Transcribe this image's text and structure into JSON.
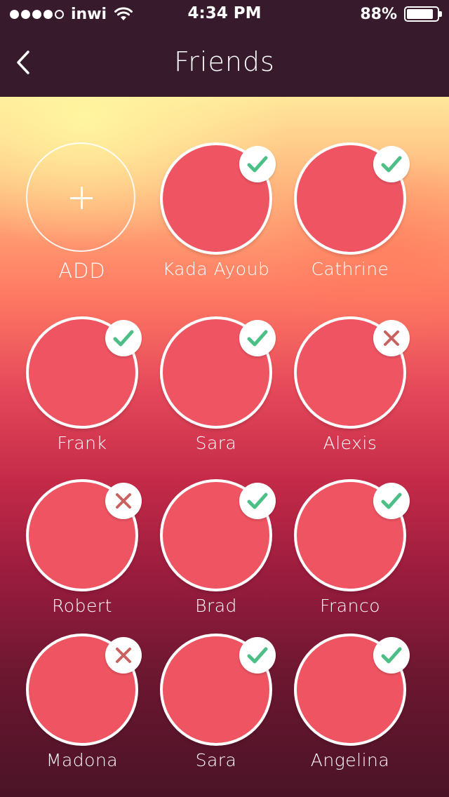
{
  "status_bar": {
    "carrier": "inwi",
    "signal_bars": 4,
    "signal_max": 5,
    "time": "4:34 PM",
    "battery": "88%",
    "battery_level": 0.88
  },
  "nav": {
    "title": "Friends",
    "back_icon": "chevron-left-icon"
  },
  "add_tile": {
    "label": "ADD",
    "icon": "plus-icon"
  },
  "colors": {
    "avatar": "#ef5462",
    "check": "#4dbf86",
    "cross": "#c9625e",
    "bar": "#371a2c"
  },
  "friends": [
    {
      "name": "Kada Ayoub",
      "status": "accepted"
    },
    {
      "name": "Cathrine",
      "status": "accepted"
    },
    {
      "name": "Frank",
      "status": "accepted"
    },
    {
      "name": "Sara",
      "status": "accepted"
    },
    {
      "name": "Alexis",
      "status": "declined"
    },
    {
      "name": "Robert",
      "status": "declined"
    },
    {
      "name": "Brad",
      "status": "accepted"
    },
    {
      "name": "Franco",
      "status": "accepted"
    },
    {
      "name": "Madona",
      "status": "declined"
    },
    {
      "name": "Sara",
      "status": "accepted"
    },
    {
      "name": "Angelina",
      "status": "accepted"
    }
  ]
}
